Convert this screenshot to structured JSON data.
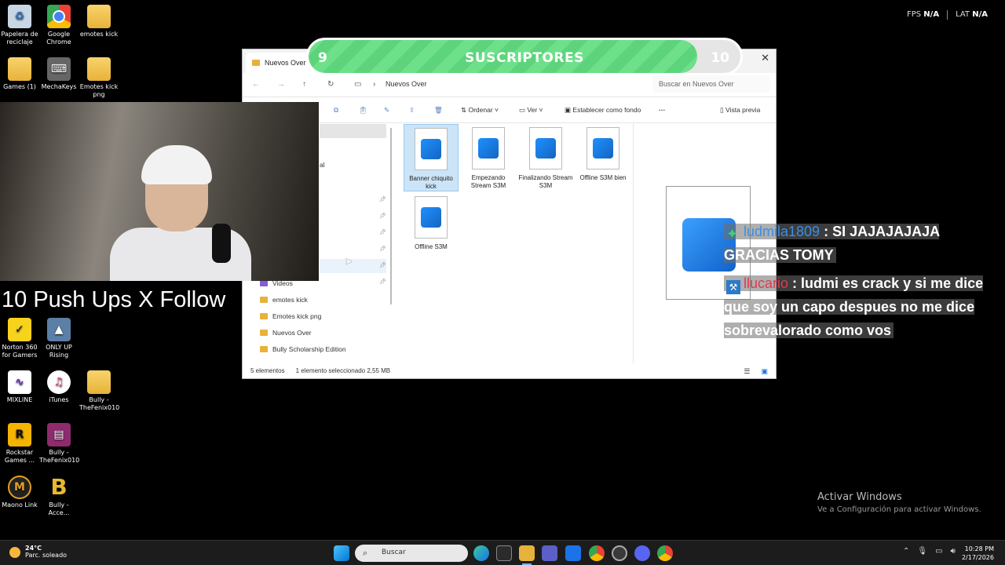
{
  "desktop": {
    "icons": [
      {
        "label": "Papelera de reciclaje",
        "icon": "recycle-bin-icon"
      },
      {
        "label": "Google Chrome",
        "icon": "chrome-icon"
      },
      {
        "label": "emotes kick",
        "icon": "folder-icon"
      },
      {
        "label": "Games (1)",
        "icon": "folder-icon"
      },
      {
        "label": "MechaKeys",
        "icon": "keyboard-app-icon"
      },
      {
        "label": "Emotes kick png",
        "icon": "folder-icon"
      },
      {
        "label": "Norton 360 for Gamers",
        "icon": "norton-icon"
      },
      {
        "label": "ONLY UP Rising",
        "icon": "game-icon"
      },
      {
        "label": "MIXLINE",
        "icon": "mixline-icon"
      },
      {
        "label": "iTunes",
        "icon": "itunes-icon"
      },
      {
        "label": "Bully - TheFenix010",
        "icon": "folder-icon"
      },
      {
        "label": "Rockstar Games ...",
        "icon": "rockstar-icon"
      },
      {
        "label": "Bully - TheFenix010",
        "icon": "winrar-icon"
      },
      {
        "label": "Maono Link",
        "icon": "maono-icon"
      },
      {
        "label": "Bully - Acce...",
        "icon": "bully-icon"
      }
    ]
  },
  "overlay": {
    "fps_label": "FPS",
    "fps_value": "N/A",
    "lat_label": "LAT",
    "lat_value": "N/A",
    "pushups": "10 Push Ups X Follow",
    "sub_goal": {
      "left": "9",
      "title": "SUSCRIPTORES",
      "right": "10",
      "progress": 0.9
    }
  },
  "explorer": {
    "tab_title": "Nuevos Over",
    "path": "Nuevos Over",
    "search_placeholder": "Buscar en Nuevos Over",
    "commands": {
      "sort": "Ordenar",
      "view": "Ver",
      "set_background": "Establecer como fondo",
      "preview": "Vista previa"
    },
    "sidebar": [
      {
        "label": "Videos"
      },
      {
        "label": "emotes kick"
      },
      {
        "label": "Emotes kick png"
      },
      {
        "label": "Nuevos Over"
      },
      {
        "label": "Bully Scholarship Edition"
      }
    ],
    "sidebar_partial": "al",
    "files": [
      {
        "name": "Banner chiquito kick",
        "selected": true
      },
      {
        "name": "Empezando Stream S3M",
        "selected": false
      },
      {
        "name": "Finalizando Stream S3M",
        "selected": false
      },
      {
        "name": "Offline S3M bien",
        "selected": false
      },
      {
        "name": "Offline S3M",
        "selected": false
      }
    ],
    "status": {
      "count": "5 elementos",
      "selection": "1 elemento seleccionado  2,55 MB"
    }
  },
  "chat": [
    {
      "user": "ludmila1809",
      "sep": " : ",
      "text": "SI JAJAJAJAJA GRACIAS TOMY"
    },
    {
      "user": "llucario",
      "sep": " : ",
      "text": "ludmi es crack y si me dice que soy un capo despues no me dice sobrevalorado como vos"
    }
  ],
  "watermark": {
    "title": "Activar Windows",
    "subtitle": "Ve a Configuración para activar Windows."
  },
  "taskbar": {
    "weather_temp": "24°C",
    "weather_desc": "Parc. soleado",
    "search_placeholder": "Buscar",
    "time": "10:28 PM",
    "date": "2/17/2026"
  },
  "colors": {
    "sub_bar_fill": "#6ee08a",
    "chat_user1": "#3a8ee6",
    "chat_user2": "#e2394c",
    "selected_file": "#cce4f7"
  }
}
